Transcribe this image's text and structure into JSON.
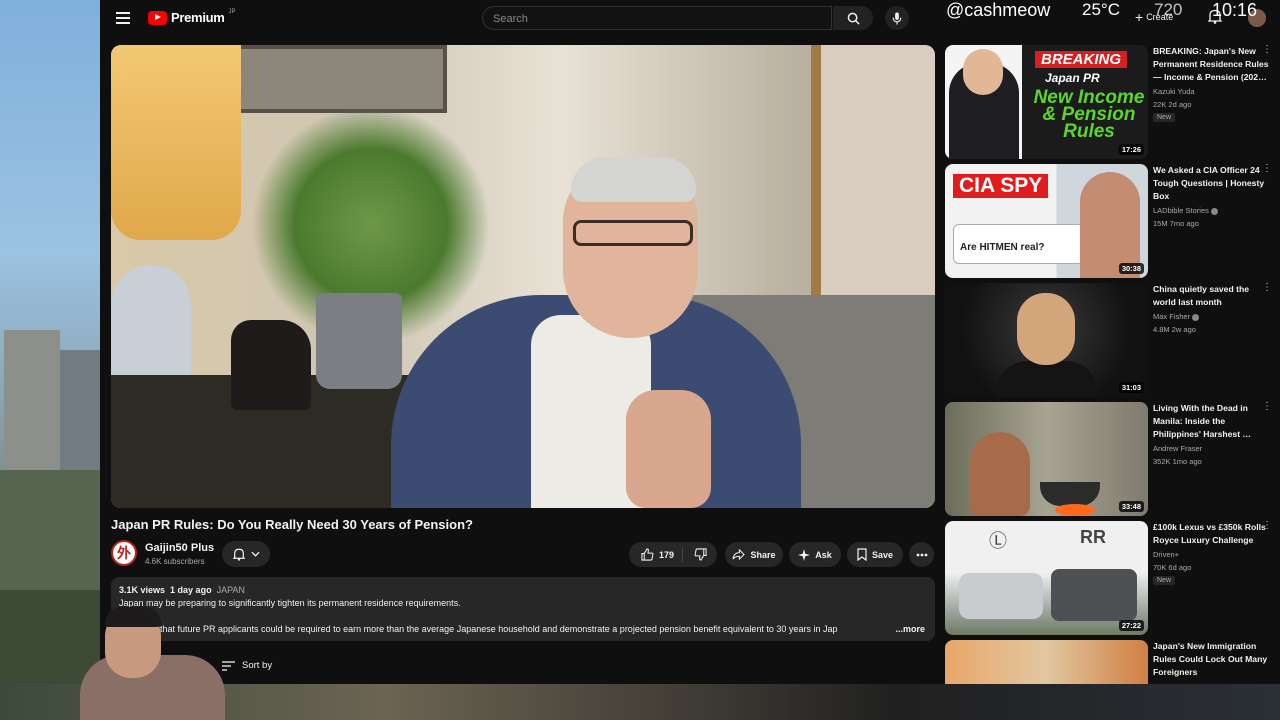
{
  "overlay": {
    "handle": "@cashmeow",
    "temperature": "25°C",
    "resolution": "720",
    "time": "10:16"
  },
  "header": {
    "logo_text": "Premium",
    "logo_sup": "JP",
    "search_placeholder": "Search",
    "create_label": "Create"
  },
  "video": {
    "title": "Japan PR Rules: Do You Really Need 30 Years of Pension?",
    "channel_name": "Gaijin50 Plus",
    "channel_avatar_text": "外",
    "subscribers": "4.6K subscribers",
    "likes": "179",
    "share_label": "Share",
    "ask_label": "Ask",
    "save_label": "Save"
  },
  "description": {
    "views": "3.1K views",
    "age": "1 day ago",
    "tag": "JAPAN",
    "line1": "Japan may be preparing to significantly tighten its permanent residence requirements.",
    "line2": "orts claim that future PR applicants could be required to earn more than the average Japanese household and demonstrate a projected pension benefit equivalent to 30 years in Jap",
    "more": "...more"
  },
  "comments": {
    "sort_label": "Sort by"
  },
  "recommendations": [
    {
      "title": "BREAKING: Japan's New Permanent Residence Rules — Income & Pension (202…",
      "channel": "Kazuki Yuda",
      "verified": false,
      "meta": "22K  2d ago",
      "badge": "New",
      "duration": "17:26",
      "thumb_text": [
        "BREAKING",
        "Japan PR",
        "New Income & Pension Rules"
      ]
    },
    {
      "title": "We Asked a CIA Officer 24 Tough Questions | Honesty Box",
      "channel": "LADbible Stories",
      "verified": true,
      "meta": "15M  7mo ago",
      "badge": "",
      "duration": "30:38",
      "thumb_text": [
        "CIA SPY",
        "Are HITMEN real?"
      ]
    },
    {
      "title": "China quietly saved the world last month",
      "channel": "Max Fisher",
      "verified": true,
      "meta": "4.8M  2w ago",
      "badge": "",
      "duration": "31:03",
      "thumb_text": []
    },
    {
      "title": "Living With the Dead in Manila: Inside the Philippines' Harshest …",
      "channel": "Andrew Fraser",
      "verified": false,
      "meta": "352K  1mo ago",
      "badge": "",
      "duration": "33:48",
      "thumb_text": []
    },
    {
      "title": "£100k Lexus vs £350k Rolls Royce Luxury Challenge",
      "channel": "Driven+",
      "verified": false,
      "meta": "70K  6d ago",
      "badge": "New",
      "duration": "27:22",
      "thumb_text": [
        "RR"
      ]
    },
    {
      "title": "Japan's New Immigration Rules Could Lock Out Many Foreigners",
      "channel": "",
      "verified": false,
      "meta": "",
      "badge": "",
      "duration": "",
      "thumb_text": []
    }
  ]
}
